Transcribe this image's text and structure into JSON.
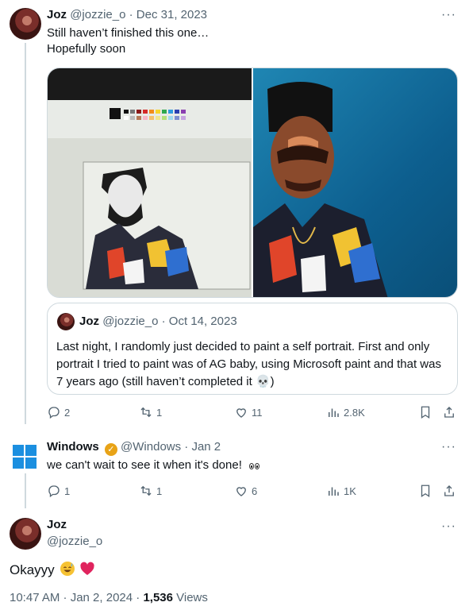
{
  "tweet1": {
    "name": "Joz",
    "handle": "@jozzie_o",
    "date": "· Dec 31, 2023",
    "line1": "Still haven’t finished this one…",
    "line2": "Hopefully soon",
    "more": "···",
    "quote": {
      "name": "Joz",
      "handle": "@jozzie_o",
      "date": "· Oct 14, 2023",
      "text": "Last night, I randomly just decided to paint a self portrait. First and only portrait I tried to paint was of AG baby, using Microsoft paint and that was 7 years ago (still haven’t completed it 💀)"
    },
    "actions": {
      "replies": "2",
      "reposts": "1",
      "likes": "11",
      "views": "2.8K"
    }
  },
  "tweet2": {
    "name": "Windows",
    "handle": "@Windows",
    "date": "· Jan 2",
    "text": "we can't wait to see it when it's done!",
    "more": "···",
    "actions": {
      "replies": "1",
      "reposts": "1",
      "likes": "6",
      "views": "1K"
    }
  },
  "main": {
    "name": "Joz",
    "handle": "@jozzie_o",
    "more": "···",
    "text": "Okayyy",
    "time": "10:47 AM · Jan 2, 2024 · ",
    "views_count": "1,536",
    "views_label": " Views"
  },
  "colors": {
    "accent": "#1d9bf0",
    "muted": "#536471",
    "windows_blue": "#1b8fe0",
    "heart": "#e0245e"
  }
}
